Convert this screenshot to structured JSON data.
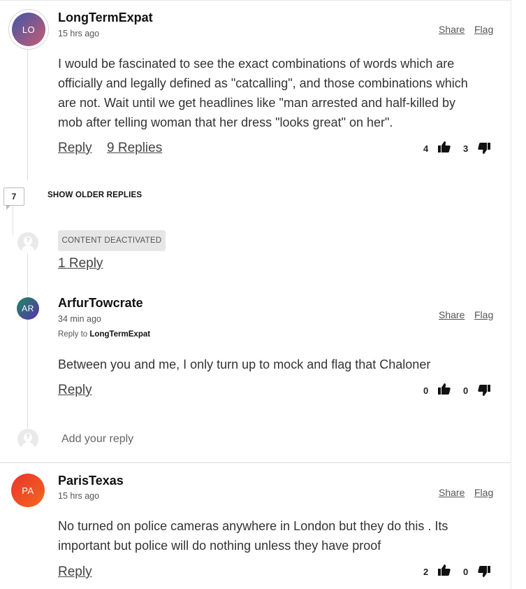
{
  "comments": [
    {
      "initials": "LO",
      "username": "LongTermExpat",
      "time": "15 hrs ago",
      "share": "Share",
      "flag": "Flag",
      "lines": [
        "I would be fascinated to see the exact combinations of words which are",
        "officially and legally defined as \"catcalling\", and those combinations which",
        "are not. Wait until we get headlines like \"man arrested and half-killed by",
        "mob after telling woman that her dress \"looks great\" on her\"."
      ],
      "reply_label": "Reply",
      "replies_label": "9 Replies",
      "upvotes": "4",
      "downvotes": "3",
      "avatar_colors": [
        "#3f57a8",
        "#c95b72"
      ]
    },
    {
      "initials": "AR",
      "username": "ArfurTowcrate",
      "time": "34 min ago",
      "reply_to_prefix": "Reply to",
      "reply_to_user": "LongTermExpat",
      "share": "Share",
      "flag": "Flag",
      "lines": [
        "Between you and me, I only turn up to mock and flag that Chaloner"
      ],
      "reply_label": "Reply",
      "upvotes": "0",
      "downvotes": "0",
      "avatar_colors": [
        "#1c8a5e",
        "#5b2fb0"
      ]
    },
    {
      "initials": "PA",
      "username": "ParisTexas",
      "time": "15 hrs ago",
      "share": "Share",
      "flag": "Flag",
      "lines": [
        "No turned on police cameras anywhere in London but they do this . Its",
        "important but police will do nothing unless they have proof"
      ],
      "reply_label": "Reply",
      "upvotes": "2",
      "downvotes": "0",
      "avatar_colors": [
        "#e8342d",
        "#f5671e"
      ]
    }
  ],
  "older_replies": {
    "count": "7",
    "label": "SHOW OLDER REPLIES"
  },
  "deactivated": {
    "label": "CONTENT DEACTIVATED",
    "replies_label": "1 Reply"
  },
  "add_reply": {
    "placeholder": "Add your reply"
  }
}
